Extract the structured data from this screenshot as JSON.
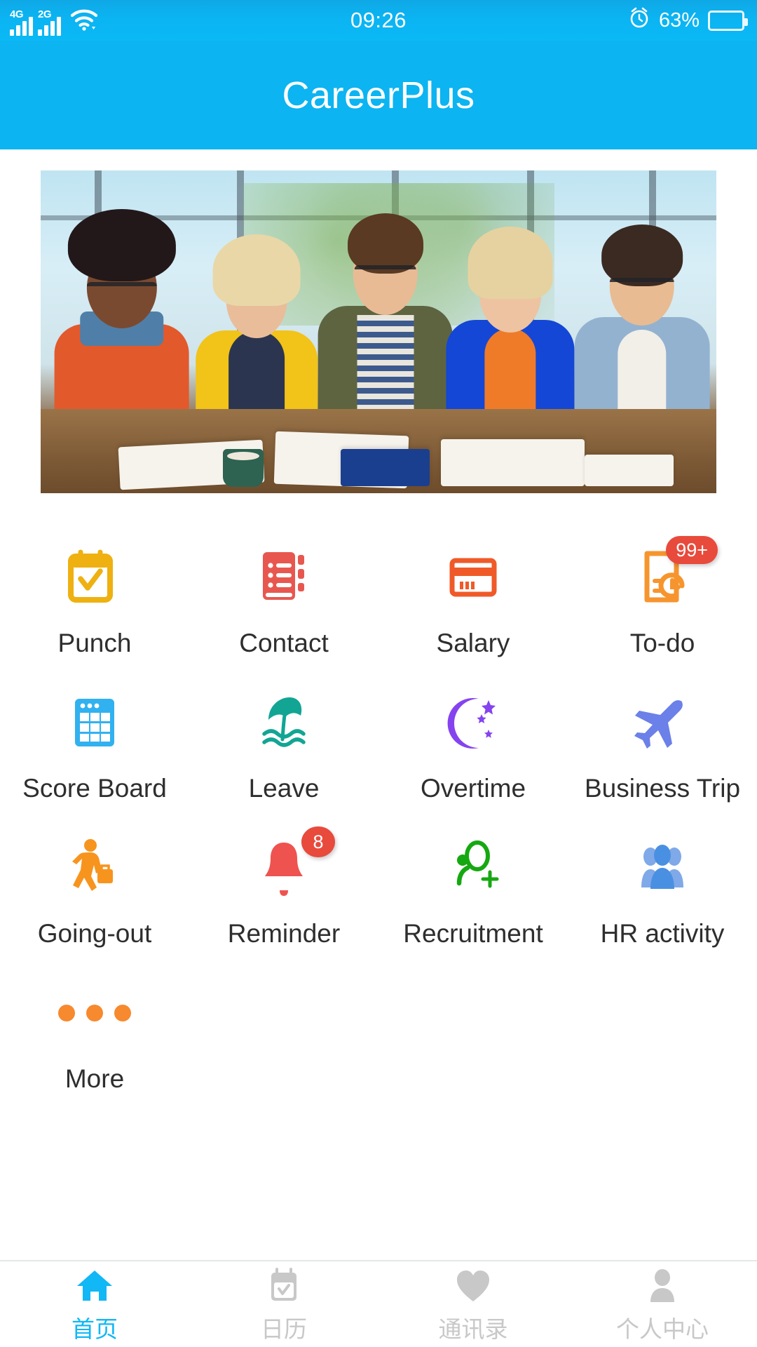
{
  "status_bar": {
    "network_primary": "4G",
    "network_secondary": "2G",
    "wifi_icon": "wifi-icon",
    "time": "09:26",
    "alarm_icon": "alarm-clock-icon",
    "battery_percent": "63%",
    "battery_level": 63
  },
  "header": {
    "title": "CareerPlus",
    "background_color": "#0cb4f1"
  },
  "banner": {
    "alt": "Five smiling colleagues sitting at a table with open books and notebooks"
  },
  "grid": {
    "items": [
      {
        "label": "Punch",
        "icon": "calendar-check-icon",
        "color": "#eeb111",
        "badge": null
      },
      {
        "label": "Contact",
        "icon": "address-book-icon",
        "color": "#e8574f",
        "badge": null
      },
      {
        "label": "Salary",
        "icon": "credit-card-icon",
        "color": "#ef5a28",
        "badge": null
      },
      {
        "label": "To-do",
        "icon": "document-clock-icon",
        "color": "#f6952e",
        "badge": "99+"
      },
      {
        "label": "Score Board",
        "icon": "grid-table-icon",
        "color": "#31b1f0",
        "badge": null
      },
      {
        "label": "Leave",
        "icon": "beach-umbrella-icon",
        "color": "#12a594",
        "badge": null
      },
      {
        "label": "Overtime",
        "icon": "moon-stars-icon",
        "color": "#8543f0",
        "badge": null
      },
      {
        "label": "Business Trip",
        "icon": "airplane-icon",
        "color": "#6b80e8",
        "badge": null
      },
      {
        "label": "Going-out",
        "icon": "walking-person-icon",
        "color": "#f7941e",
        "badge": null
      },
      {
        "label": "Reminder",
        "icon": "bell-icon",
        "color": "#ef5350",
        "badge": "8"
      },
      {
        "label": "Recruitment",
        "icon": "person-plus-icon",
        "color": "#16a811",
        "badge": null
      },
      {
        "label": "HR activity",
        "icon": "people-group-icon",
        "color": "#4a90e2",
        "badge": null
      },
      {
        "label": "More",
        "icon": "more-dots-icon",
        "color": "#f7892f",
        "badge": null
      }
    ],
    "badge_color": "#e84a3c"
  },
  "tab_bar": {
    "active_color": "#12b7f5",
    "inactive_color": "#c8c8c8",
    "tabs": [
      {
        "label": "首页",
        "icon": "home-icon",
        "active": true
      },
      {
        "label": "日历",
        "icon": "calendar-icon",
        "active": false
      },
      {
        "label": "通讯录",
        "icon": "heart-icon",
        "active": false
      },
      {
        "label": "个人中心",
        "icon": "person-icon",
        "active": false
      }
    ]
  }
}
